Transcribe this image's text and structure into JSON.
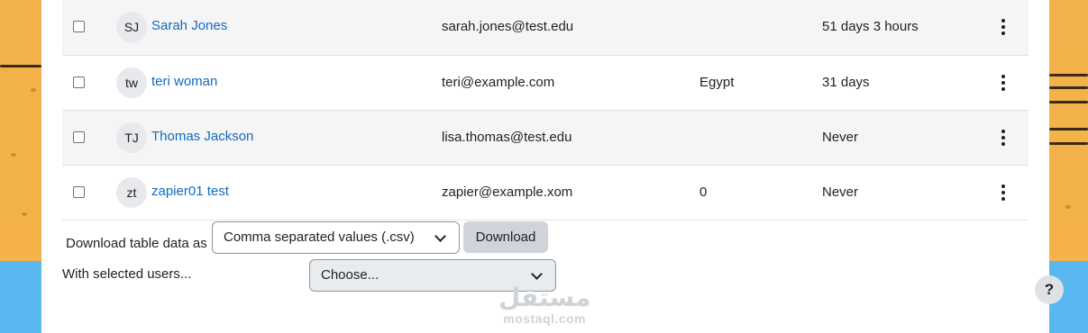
{
  "users": [
    {
      "initials": "SJ",
      "name": "Sarah Jones",
      "email": "sarah.jones@test.edu",
      "country": "",
      "last_access": "51 days 3 hours"
    },
    {
      "initials": "tw",
      "name": "teri woman",
      "email": "teri@example.com",
      "country": "Egypt",
      "last_access": "31 days"
    },
    {
      "initials": "TJ",
      "name": "Thomas Jackson",
      "email": "lisa.thomas@test.edu",
      "country": "",
      "last_access": "Never"
    },
    {
      "initials": "zt",
      "name": "zapier01 test",
      "email": "zapier@example.xom",
      "country": "0",
      "last_access": "Never"
    }
  ],
  "download": {
    "label": "Download table data as",
    "format_selected": "Comma separated values (.csv)",
    "button": "Download"
  },
  "bulk": {
    "label": "With selected users...",
    "select_value": "Choose..."
  },
  "watermark": {
    "arabic": "مستقل",
    "latin": "mostaql.com"
  },
  "help": {
    "label": "?"
  }
}
